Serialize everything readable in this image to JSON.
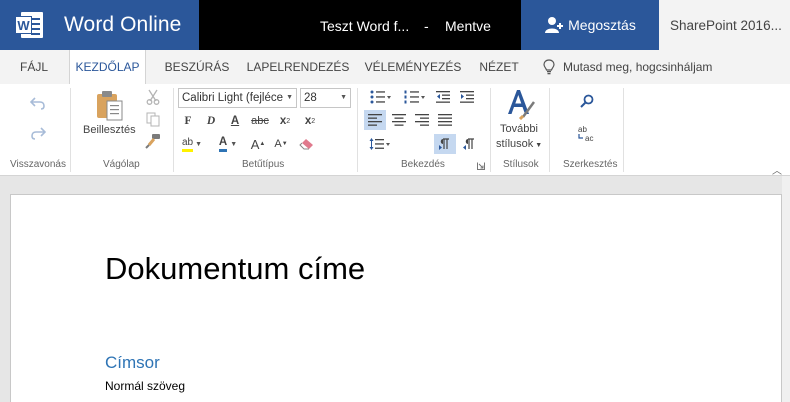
{
  "app": {
    "name": "Word Online",
    "logo_letter": "W",
    "doc_title": "Teszt Word f...",
    "separator": "-",
    "status": "Mentve",
    "share_label": "Megosztás",
    "sharepoint": "SharePoint 2016...",
    "brand_color": "#2b579a"
  },
  "tabs": [
    {
      "label": "FÁJL"
    },
    {
      "label": "KEZDŐLAP",
      "active": true
    },
    {
      "label": "BESZÚRÁS"
    },
    {
      "label": "LAPELRENDEZÉS"
    },
    {
      "label": "VÉLEMÉNYEZÉS"
    },
    {
      "label": "NÉZET"
    }
  ],
  "tell_me": "Mutasd meg, hogcsinháljam",
  "ribbon": {
    "groups": {
      "undo": "Visszavonás",
      "clipboard": "Vágólap",
      "font": "Betűtípus",
      "paragraph": "Bekezdés",
      "styles": "Stílusok",
      "editing": "Szerkesztés"
    },
    "paste_label": "Beillesztés",
    "font_name": "Calibri Light (fejléce",
    "font_size": "28",
    "more_styles_line1": "További",
    "more_styles_line2": "stílusok",
    "format": {
      "bold": "F",
      "italic": "D",
      "underline": "A",
      "strike": "abc",
      "sub": "x",
      "sup": "x",
      "sub_mark": "2",
      "sup_mark": "2",
      "highlight": "ab",
      "fontcolor": "A",
      "grow": "A",
      "shrink": "A"
    }
  },
  "document": {
    "title": "Dokumentum címe",
    "heading": "Címsor",
    "body": "Normál szöveg"
  }
}
